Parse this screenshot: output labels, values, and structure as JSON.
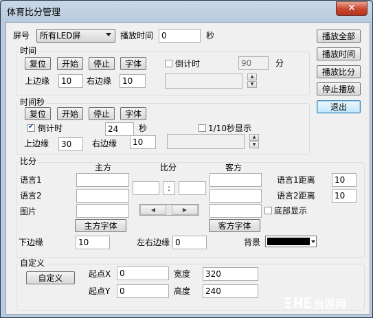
{
  "window": {
    "title": "体育比分管理",
    "close_glyph": "✕"
  },
  "top": {
    "screen_label": "屏号",
    "screen_value": "所有LED屏",
    "play_time_label": "播放时间",
    "play_time_value": "0",
    "sec_unit": "秒"
  },
  "right_buttons": {
    "play_all": "播放全部",
    "play_time": "播放时间",
    "play_score": "播放比分",
    "stop_play": "停止播放",
    "exit": "退出"
  },
  "time": {
    "group_label": "时间",
    "reset": "复位",
    "start": "开始",
    "stop": "停止",
    "font": "字体",
    "countdown_label": "倒计时",
    "countdown_checked": false,
    "countdown_value": "90",
    "minute_unit": "分",
    "top_margin_label": "上边缘",
    "top_margin_value": "10",
    "right_margin_label": "右边缘",
    "right_margin_value": "10",
    "display_value": ""
  },
  "time_sec": {
    "group_label": "时间秒",
    "reset": "复位",
    "start": "开始",
    "stop": "停止",
    "font": "字体",
    "countdown_label": "倒计时",
    "countdown_checked": true,
    "countdown_value": "24",
    "sec_unit": "秒",
    "tenth_label": "1/10秒显示",
    "tenth_checked": false,
    "top_margin_label": "上边缘",
    "top_margin_value": "30",
    "right_margin_label": "右边缘",
    "right_margin_value": "10",
    "display_value": ""
  },
  "score": {
    "group_label": "比分",
    "home_header": "主方",
    "score_header": "比分",
    "away_header": "客方",
    "lang1_label": "语言1",
    "lang2_label": "语言2",
    "image_label": "图片",
    "home_lang1": "",
    "home_lang2": "",
    "home_image": "",
    "away_lang1": "",
    "away_lang2": "",
    "away_image": "",
    "score_home": "",
    "score_sep": ":",
    "score_away": "",
    "lang1_dist_label": "语言1距离",
    "lang1_dist_value": "10",
    "lang2_dist_label": "语言2距离",
    "lang2_dist_value": "10",
    "bottom_display_label": "底部显示",
    "bottom_display_checked": false,
    "home_font_button": "主方字体",
    "away_font_button": "客方字体",
    "bottom_margin_label": "下边缘",
    "bottom_margin_value": "10",
    "lr_margin_label": "左右边缘",
    "lr_margin_value": "0",
    "background_label": "背景",
    "background_color": "#000000"
  },
  "custom": {
    "group_label": "自定义",
    "custom_button": "自定义",
    "start_x_label": "起点X",
    "start_x_value": "0",
    "width_label": "宽度",
    "width_value": "320",
    "start_y_label": "起点Y",
    "start_y_value": "0",
    "height_label": "高度",
    "height_value": "240"
  },
  "watermark": {
    "text": "当游网"
  }
}
